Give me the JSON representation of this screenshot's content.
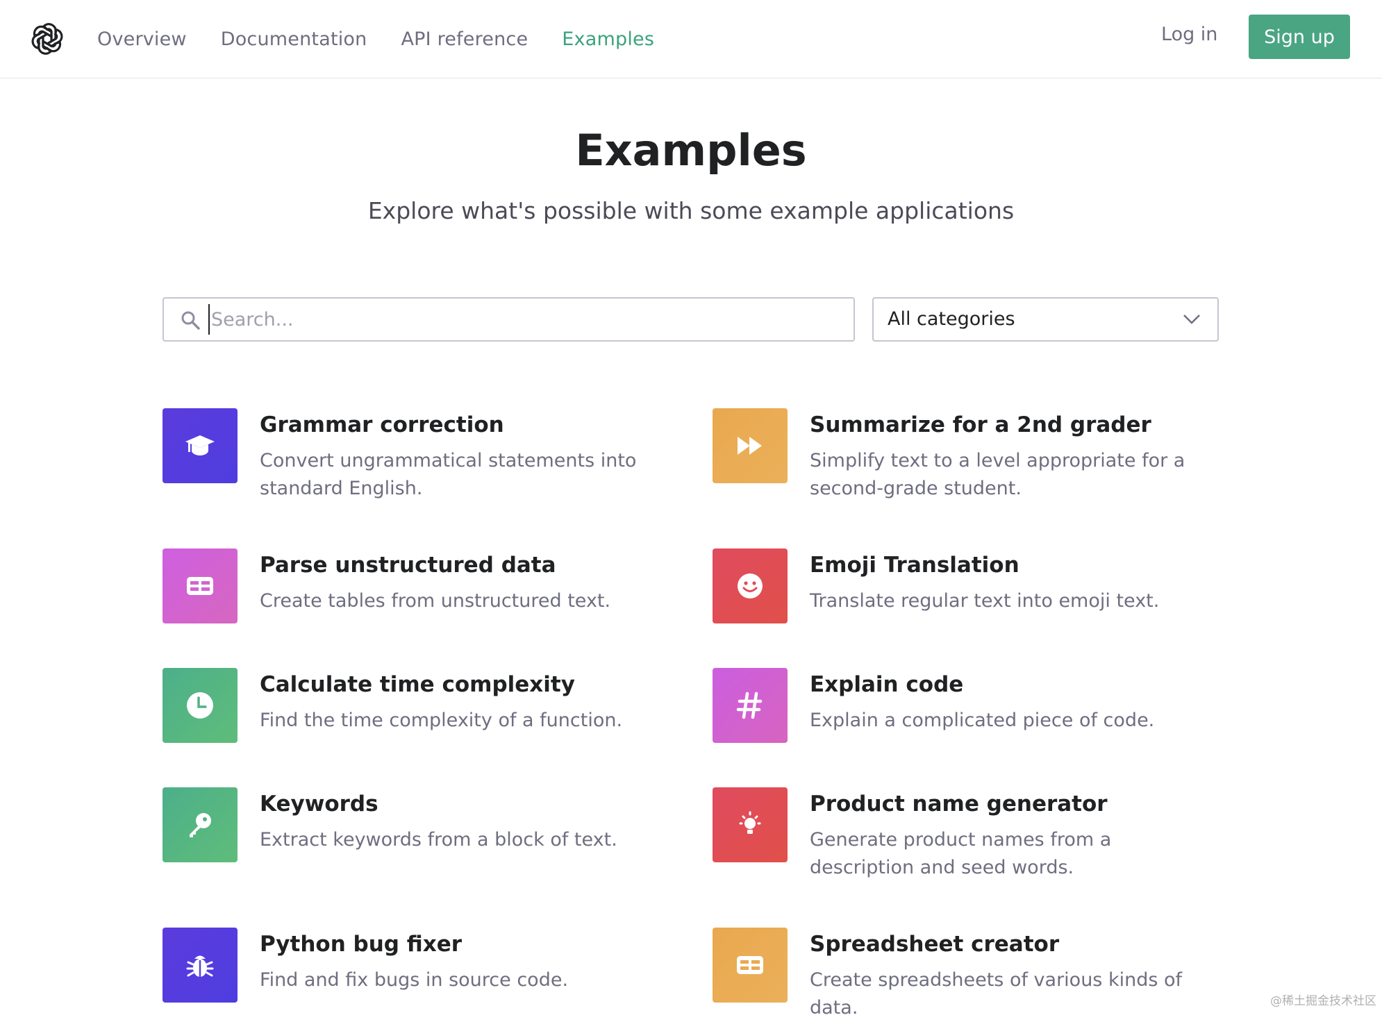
{
  "nav": {
    "items": [
      {
        "label": "Overview"
      },
      {
        "label": "Documentation"
      },
      {
        "label": "API reference"
      },
      {
        "label": "Examples"
      }
    ],
    "login_label": "Log in",
    "signup_label": "Sign up",
    "accent_color": "#4aa582"
  },
  "hero": {
    "title": "Examples",
    "subtitle": "Explore what's possible with some example applications"
  },
  "filters": {
    "search_placeholder": "Search...",
    "category_selected": "All categories"
  },
  "examples": [
    {
      "title": "Grammar correction",
      "description": "Convert ungrammatical statements into standard English.",
      "icon": "graduation-cap-icon",
      "color_from": "#5b3cdc",
      "color_to": "#4f3de0"
    },
    {
      "title": "Summarize for a 2nd grader",
      "description": "Simplify text to a level appropriate for a second-grade student.",
      "icon": "fast-forward-icon",
      "color_from": "#e9a84f",
      "color_to": "#eab05a"
    },
    {
      "title": "Parse unstructured data",
      "description": "Create tables from unstructured text.",
      "icon": "table-icon",
      "color_from": "#cf5fe0",
      "color_to": "#d667c0"
    },
    {
      "title": "Emoji Translation",
      "description": "Translate regular text into emoji text.",
      "icon": "smiley-icon",
      "color_from": "#e04b5e",
      "color_to": "#e0504a"
    },
    {
      "title": "Calculate time complexity",
      "description": "Find the time complexity of a function.",
      "icon": "clock-icon",
      "color_from": "#4caf8a",
      "color_to": "#5fbd7a"
    },
    {
      "title": "Explain code",
      "description": "Explain a complicated piece of code.",
      "icon": "hashtag-icon",
      "color_from": "#cb5ee0",
      "color_to": "#d764bf"
    },
    {
      "title": "Keywords",
      "description": "Extract keywords from a block of text.",
      "icon": "key-icon",
      "color_from": "#4caf8a",
      "color_to": "#5fbd7a"
    },
    {
      "title": "Product name generator",
      "description": "Generate product names from a description and seed words.",
      "icon": "lightbulb-icon",
      "color_from": "#e04b5e",
      "color_to": "#e0504a"
    },
    {
      "title": "Python bug fixer",
      "description": "Find and fix bugs in source code.",
      "icon": "bug-icon",
      "color_from": "#5b3cdc",
      "color_to": "#4f3de0"
    },
    {
      "title": "Spreadsheet creator",
      "description": "Create spreadsheets of various kinds of data.",
      "icon": "table-icon",
      "color_from": "#e9a84f",
      "color_to": "#eab05a"
    }
  ],
  "watermark": "@稀土掘金技术社区"
}
